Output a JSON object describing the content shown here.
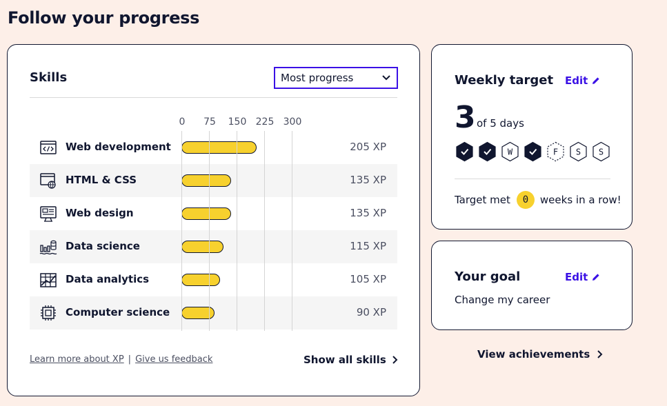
{
  "page": {
    "title": "Follow your progress"
  },
  "skills": {
    "heading": "Skills",
    "sort": {
      "selected": "Most progress"
    },
    "axis": {
      "ticks": [
        "0",
        "75",
        "150",
        "225",
        "300"
      ],
      "max": 300
    },
    "items": [
      {
        "name": "Web development",
        "xp": 205,
        "xp_label": "205 XP",
        "icon": "code-window-icon"
      },
      {
        "name": "HTML & CSS",
        "xp": 135,
        "xp_label": "135 XP",
        "icon": "browser-globe-icon"
      },
      {
        "name": "Web design",
        "xp": 135,
        "xp_label": "135 XP",
        "icon": "design-layout-icon"
      },
      {
        "name": "Data science",
        "xp": 115,
        "xp_label": "115 XP",
        "icon": "data-bars-icon"
      },
      {
        "name": "Data analytics",
        "xp": 105,
        "xp_label": "105 XP",
        "icon": "analytics-table-icon"
      },
      {
        "name": "Computer science",
        "xp": 90,
        "xp_label": "90 XP",
        "icon": "cpu-chip-icon"
      }
    ],
    "footer": {
      "learn_more": "Learn more about XP",
      "separator": "|",
      "feedback": "Give us feedback",
      "show_all": "Show all skills"
    }
  },
  "weekly_target": {
    "heading": "Weekly target",
    "edit_label": "Edit",
    "count": "3",
    "of_days": "of 5 days",
    "days": [
      {
        "letter": "",
        "state": "done"
      },
      {
        "letter": "",
        "state": "done"
      },
      {
        "letter": "W",
        "state": "open"
      },
      {
        "letter": "",
        "state": "done"
      },
      {
        "letter": "F",
        "state": "today"
      },
      {
        "letter": "S",
        "state": "open"
      },
      {
        "letter": "S",
        "state": "open"
      }
    ],
    "streak_prefix": "Target met",
    "streak_weeks": "0",
    "streak_suffix": "weeks in a row!"
  },
  "goal": {
    "heading": "Your goal",
    "edit_label": "Edit",
    "text": "Change my career"
  },
  "achievements": {
    "label": "View achievements"
  },
  "colors": {
    "background": "#fdefe8",
    "accent": "#3a10e5",
    "bar": "#f7d12e",
    "navy": "#10162f"
  }
}
